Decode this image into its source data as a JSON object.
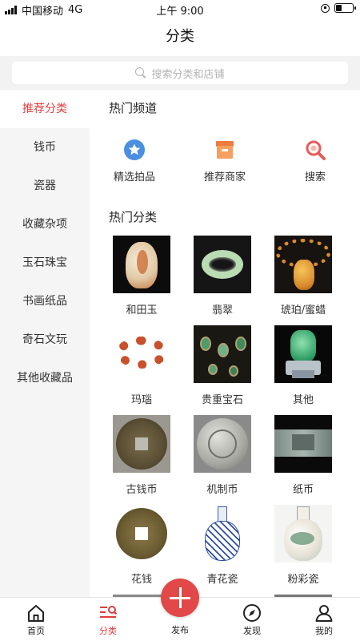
{
  "status": {
    "carrier": "中国移动",
    "network": "4G",
    "time": "上午 9:00"
  },
  "header": {
    "title": "分类"
  },
  "search": {
    "placeholder": "搜索分类和店铺"
  },
  "sidebar": {
    "items": [
      {
        "label": "推荐分类",
        "active": true
      },
      {
        "label": "钱币"
      },
      {
        "label": "瓷器"
      },
      {
        "label": "收藏杂项"
      },
      {
        "label": "玉石珠宝"
      },
      {
        "label": "书画纸品"
      },
      {
        "label": "奇石文玩"
      },
      {
        "label": "其他收藏品"
      }
    ]
  },
  "main": {
    "hot_channels_title": "热门频道",
    "channels": [
      {
        "label": "精选拍品",
        "icon": "star-badge-icon",
        "color": "#4a8fe2"
      },
      {
        "label": "推荐商家",
        "icon": "shop-icon",
        "color": "#f07b3f"
      },
      {
        "label": "搜索",
        "icon": "magnifier-icon",
        "color": "#e85a5a"
      }
    ],
    "hot_categories_title": "热门分类",
    "categories": [
      {
        "label": "和田玉"
      },
      {
        "label": "翡翠"
      },
      {
        "label": "琥珀/蜜蜡"
      },
      {
        "label": "玛瑙"
      },
      {
        "label": "贵重宝石"
      },
      {
        "label": "其他"
      },
      {
        "label": "古钱币"
      },
      {
        "label": "机制币"
      },
      {
        "label": "纸币"
      },
      {
        "label": "花钱"
      },
      {
        "label": "青花瓷"
      },
      {
        "label": "粉彩瓷"
      }
    ]
  },
  "tabbar": {
    "items": [
      {
        "label": "首页"
      },
      {
        "label": "分类",
        "active": true
      },
      {
        "label": "发布"
      },
      {
        "label": "发现"
      },
      {
        "label": "我的"
      }
    ]
  },
  "colors": {
    "accent": "#e03e3e",
    "sidebar_bg": "#f5f5f5",
    "search_bg": "#f2f2f2"
  }
}
